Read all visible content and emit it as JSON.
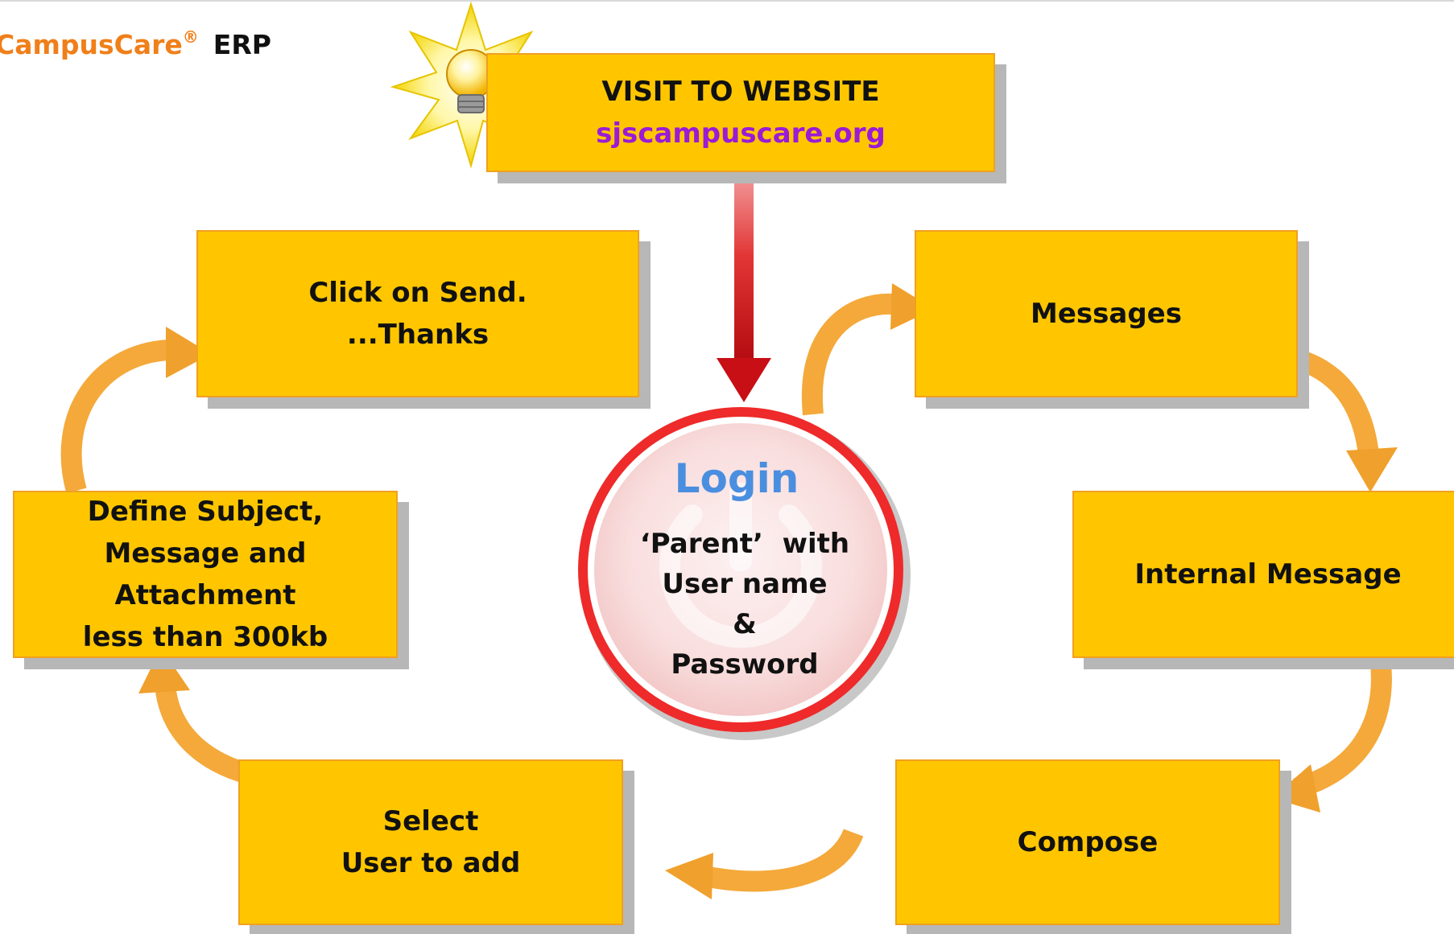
{
  "header": {
    "brand_name": "CampusCare",
    "registered_mark": "®",
    "suffix": "ERP"
  },
  "icons": {
    "bulb": "lightbulb-icon",
    "login": "power-icon"
  },
  "colors": {
    "box_fill": "#ffc600",
    "box_border": "#f0a020",
    "arrow_orange": "#f4a93a",
    "arrow_red": "#d51016",
    "brand_orange": "#f07f1a",
    "url_purple": "#9b1bd6",
    "login_blue": "#4a8ee0",
    "login_ring": "#ee2a2a"
  },
  "steps": {
    "visit": {
      "line1": "VISIT TO WEBSITE",
      "url": "sjscampuscare.org"
    },
    "messages": {
      "label": "Messages"
    },
    "internal": {
      "label": "Internal Message"
    },
    "compose": {
      "label": "Compose"
    },
    "select": {
      "line1": "Select",
      "line2": "User to add"
    },
    "define": {
      "line1": "Define Subject,",
      "line2": "Message and Attachment",
      "line3": "less than 300kb"
    },
    "send": {
      "line1": "Click on Send.",
      "line2": "...Thanks"
    }
  },
  "login": {
    "title": "Login",
    "line1": "‘Parent’  with",
    "line2": "User name",
    "line3": "&",
    "line4": "Password"
  }
}
